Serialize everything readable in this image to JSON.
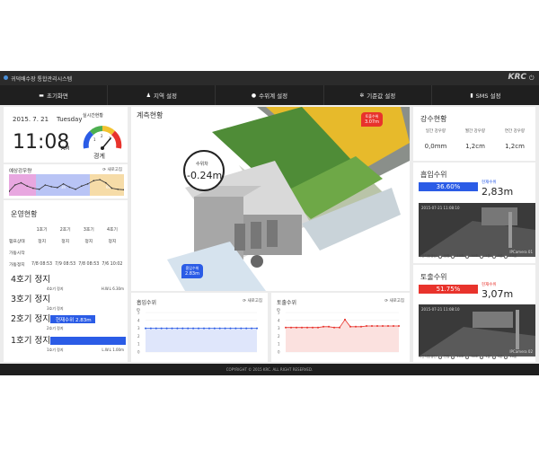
{
  "app": {
    "title": "귀덕배수장 통합관리시스템",
    "brand": "KRC",
    "exit_icon": "exit-icon"
  },
  "nav": [
    {
      "label": "초기화면",
      "icon": "monitor-icon"
    },
    {
      "label": "지역 설정",
      "icon": "person-icon"
    },
    {
      "label": "수위계 설정",
      "icon": "drop-icon"
    },
    {
      "label": "기준값 설정",
      "icon": "gears-icon"
    },
    {
      "label": "SMS 설정",
      "icon": "mobile-icon"
    }
  ],
  "clock": {
    "date": "2015. 7. 21",
    "weekday": "Tuesday",
    "time": "11:08",
    "ampm": "AM"
  },
  "gauge": {
    "label": "실시간현황",
    "status": "경계",
    "ticks": [
      "1",
      "2",
      "3"
    ],
    "level": 0.72
  },
  "forecast": {
    "title": "예상강우량",
    "refresh": "새로고침",
    "legend": [
      "3h",
      "6h"
    ],
    "values": [
      0.2,
      0.5,
      0.6,
      0.45,
      0.35,
      0.3,
      0.5,
      0.42,
      0.38,
      0.55,
      0.4,
      0.3,
      0.45,
      0.55,
      0.7,
      0.75,
      0.6,
      0.35,
      0.3,
      0.28
    ]
  },
  "operation": {
    "title": "운영현황",
    "headers": [
      "",
      "1호기",
      "2호기",
      "3호기",
      "4호기"
    ],
    "rows": [
      [
        "펌프상태",
        "정지",
        "정지",
        "정지",
        "정지"
      ],
      [
        "가동시작",
        "",
        "",
        "",
        ""
      ],
      [
        "가동정지",
        "7/8 08:53",
        "7/9 08:53",
        "7/8 08:53",
        "7/6 10:02"
      ]
    ]
  },
  "pumps": [
    {
      "label": "4호기 정지",
      "sub": "4호기 정지",
      "right": "H.W.L 6.30m",
      "bar": 0,
      "bar_text": ""
    },
    {
      "label": "3호기 정지",
      "sub": "3호기 정지",
      "right": "",
      "bar": 0,
      "bar_text": ""
    },
    {
      "label": "2호기 정지",
      "sub": "2호기 정지",
      "right": "",
      "bar": 0.6,
      "bar_text": "현재수위 2.83m"
    },
    {
      "label": "1호기 정지",
      "sub": "1호기 정지",
      "right": "L.W.L 1.00m",
      "bar": 1.0,
      "bar_text": ""
    }
  ],
  "scene": {
    "title": "계측현황",
    "water_label": "수위차",
    "water_value": "-0.24m",
    "out_label": "토출수위",
    "out_value": "3.07m",
    "in_label": "흡입수위",
    "in_value": "2.83m"
  },
  "intake_chart": {
    "title": "흡입수위",
    "refresh": "새로고침",
    "unit": "m",
    "y_ticks": [
      "5",
      "4",
      "3",
      "2",
      "1",
      "0"
    ],
    "values": [
      3.0,
      3.0,
      3.0,
      3.0,
      3.0,
      3.0,
      3.0,
      3.0,
      3.0,
      3.0,
      3.0,
      3.0,
      3.0,
      3.0,
      3.0,
      3.0,
      3.0,
      3.0,
      3.0,
      3.0,
      3.0,
      3.0
    ]
  },
  "outflow_chart": {
    "title": "토출수위",
    "refresh": "새로고침",
    "unit": "m",
    "y_ticks": [
      "5",
      "4",
      "3",
      "2",
      "1",
      "0"
    ],
    "values": [
      3.1,
      3.1,
      3.1,
      3.1,
      3.1,
      3.1,
      3.1,
      3.2,
      3.2,
      3.1,
      3.1,
      4.1,
      3.2,
      3.2,
      3.2,
      3.3,
      3.3,
      3.3,
      3.3,
      3.3,
      3.3,
      3.3
    ]
  },
  "rainfall": {
    "title": "강수현황",
    "cols": [
      {
        "label": "일간 강우량",
        "value": "0,0mm"
      },
      {
        "label": "월간 강우량",
        "value": "1,2cm"
      },
      {
        "label": "연간 강우량",
        "value": "1,2cm"
      }
    ]
  },
  "intake_level": {
    "title": "흡입수위",
    "percent": "36.60%",
    "fraction": 0.366,
    "now_label": "현재수위",
    "value": "2,83m",
    "cam_ts": "2015-07-21 11:08:10",
    "cam_id": "IPCamera 01",
    "legend_title": "시간자동갱신",
    "legend_opts": [
      "안함",
      "10초",
      "30초",
      "1분",
      "5분",
      "10분"
    ]
  },
  "outflow_level": {
    "title": "토출수위",
    "percent": "51.75%",
    "fraction": 0.5175,
    "now_label": "현재수위",
    "value": "3,07m",
    "cam_ts": "2015-07-21 11:08:10",
    "cam_id": "IPCamera 02",
    "legend_title": "시간자동갱신",
    "legend_opts": [
      "안함",
      "10초",
      "30초",
      "1분",
      "5분",
      "10분"
    ]
  },
  "colors": {
    "intake": "#2b5ce6",
    "outflow": "#e8332c",
    "nav_bg": "#1f1f1f",
    "title_bg": "#2b2b2b"
  },
  "footer": "COPYRIGHT © 2015 KRC. ALL RIGHT RESERVED."
}
